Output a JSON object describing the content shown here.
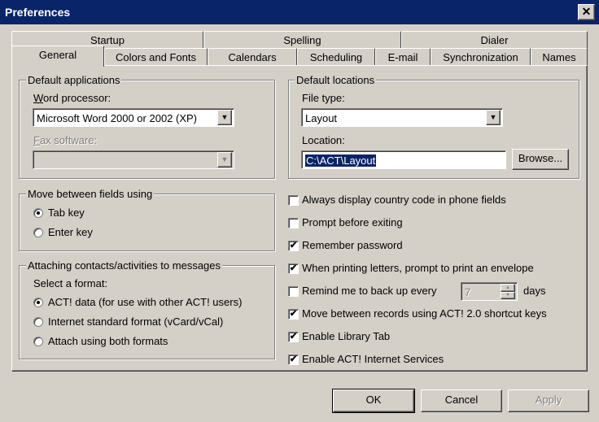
{
  "window": {
    "title": "Preferences",
    "close_glyph": "✕"
  },
  "tabs_back": [
    "Startup",
    "Spelling",
    "Dialer"
  ],
  "tabs_front": [
    "General",
    "Colors and Fonts",
    "Calendars",
    "Scheduling",
    "E-mail",
    "Synchronization",
    "Names"
  ],
  "active_tab": "General",
  "default_applications": {
    "title": "Default applications",
    "word_label": "Word processor:",
    "word_value": "Microsoft Word 2000 or 2002 (XP)",
    "fax_label": "Fax software:",
    "fax_value": ""
  },
  "default_locations": {
    "title": "Default locations",
    "filetype_label": "File type:",
    "filetype_value": "Layout",
    "location_label": "Location:",
    "location_value": "C:\\ACT\\Layout",
    "browse_label": "Browse..."
  },
  "move_between": {
    "title": "Move between fields using",
    "options": [
      "Tab key",
      "Enter key"
    ],
    "selected": "Tab key"
  },
  "attaching": {
    "title": "Attaching contacts/activities to messages",
    "select_label": "Select a format:",
    "options": [
      "ACT! data (for use with other ACT! users)",
      "Internet standard format (vCard/vCal)",
      "Attach using both formats"
    ],
    "selected": "ACT! data (for use with other ACT! users)"
  },
  "options": [
    {
      "label": "Always display country code in phone fields",
      "checked": false
    },
    {
      "label": "Prompt before exiting",
      "checked": false
    },
    {
      "label": "Remember password",
      "checked": true
    },
    {
      "label": "When printing letters, prompt to print an envelope",
      "checked": true
    },
    {
      "label": "Remind me to back up every",
      "checked": false
    },
    {
      "label": "Move between records using ACT! 2.0 shortcut keys",
      "checked": true
    },
    {
      "label": "Enable Library Tab",
      "checked": true
    },
    {
      "label": "Enable ACT! Internet Services",
      "checked": true
    }
  ],
  "backup": {
    "days_value": "7",
    "days_label": "days"
  },
  "buttons": {
    "ok": "OK",
    "cancel": "Cancel",
    "apply": "Apply"
  },
  "glyphs": {
    "check": "✔",
    "dropdown": "▼",
    "spin_up": "▲",
    "spin_down": "▼"
  },
  "colors": {
    "titlebar": "#0a246a",
    "face": "#d4d0c8",
    "selection": "#0a246a"
  }
}
